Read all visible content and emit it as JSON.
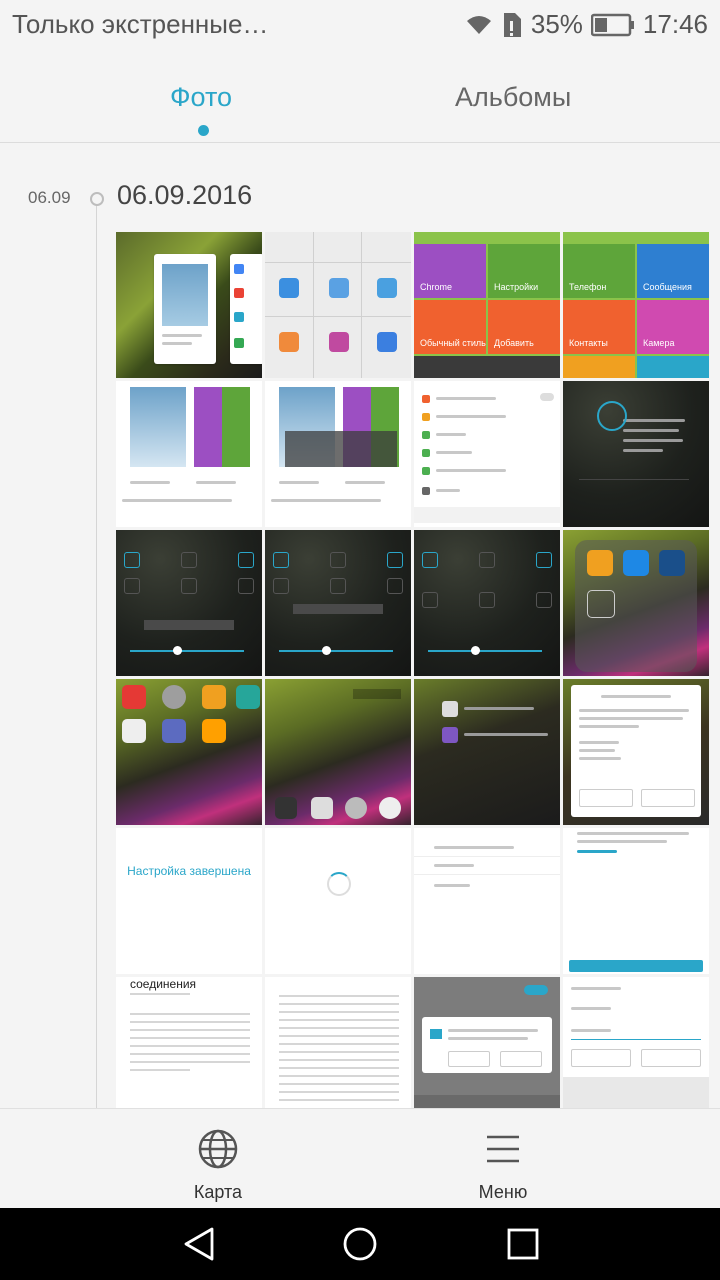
{
  "status_bar": {
    "carrier_text": "Только экстренные…",
    "battery_percent": "35%",
    "time": "17:46",
    "icons": [
      "wifi-icon",
      "sim-icon",
      "battery-icon"
    ]
  },
  "tabs": [
    {
      "label": "Фото",
      "active": true
    },
    {
      "label": "Альбомы",
      "active": false
    }
  ],
  "timeline": {
    "date_short": "06.09",
    "date_full": "06.09.2016"
  },
  "thumbnails": {
    "t01": {
      "labels": []
    },
    "t02": {
      "labels": []
    },
    "t03": {
      "labels": [
        "Chrome",
        "Настройки",
        "Обычный стиль",
        "Добавить"
      ]
    },
    "t04": {
      "labels": [
        "Телефон",
        "Сообщения",
        "Контакты",
        "Камера"
      ]
    },
    "t17": {
      "labels": [
        "Настройка завершена"
      ]
    },
    "t21": {
      "labels": [
        "соединения"
      ]
    }
  },
  "bottom_nav": {
    "map": {
      "label": "Карта",
      "icon": "globe-icon"
    },
    "menu": {
      "label": "Меню",
      "icon": "hamburger-menu-icon"
    }
  },
  "system_nav": {
    "icons": [
      "back-icon",
      "home-icon",
      "recent-apps-icon"
    ]
  },
  "colors": {
    "accent": "#2aa6c9",
    "background": "#f4f4f4"
  }
}
